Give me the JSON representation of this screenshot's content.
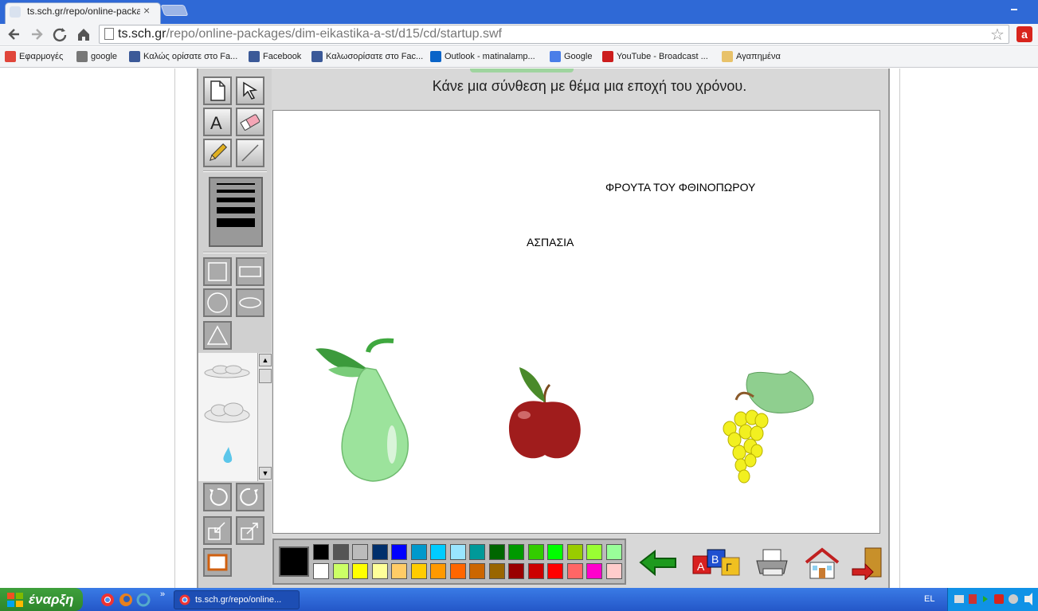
{
  "browser": {
    "tab_title": "ts.sch.gr/repo/online-packag",
    "tab_close": "×",
    "url_host": "ts.sch.gr",
    "url_path": "/repo/online-packages/dim-eikastika-a-st/d15/cd/startup.swf",
    "bookmarks": [
      {
        "label": "Εφαρμογές",
        "icon": "apps-icon",
        "color": "#e0453a"
      },
      {
        "label": "google",
        "icon": "search-icon",
        "color": "#777777"
      },
      {
        "label": "Καλώς ορίσατε στο Fa...",
        "icon": "facebook-icon",
        "color": "#3b5998"
      },
      {
        "label": "Facebook",
        "icon": "facebook-icon",
        "color": "#3b5998"
      },
      {
        "label": "Καλωσορίσατε στο Fac...",
        "icon": "facebook-icon",
        "color": "#3b5998"
      },
      {
        "label": "Outlook - matinalamp...",
        "icon": "outlook-icon",
        "color": "#0a64c8"
      },
      {
        "label": "Google",
        "icon": "google-icon",
        "color": "#4a7ee8"
      },
      {
        "label": "YouTube - Broadcast ...",
        "icon": "youtube-icon",
        "color": "#cc1d1d"
      },
      {
        "label": "Αγαπημένα",
        "icon": "folder-icon",
        "color": "#e8c26a"
      }
    ]
  },
  "app": {
    "instruction": "Κάνε μια σύνθεση με θέμα μια εποχή του χρόνου.",
    "canvas_texts": {
      "title": "ΦΡΟΥΤΑ ΤΟΥ ΦΘΙΝΟΠΩΡΟΥ",
      "name": "ΑΣΠΑΣΙΑ"
    },
    "current_color": "#000000",
    "palette_top": [
      "#000000",
      "#555555",
      "#bbbbbb",
      "#002f6c",
      "#0000ff",
      "#0099cc",
      "#00ccff",
      "#99e5ff",
      "#009999",
      "#006600",
      "#009900",
      "#33cc00",
      "#00ff00",
      "#99cc00",
      "#99ff33",
      "#99ff99"
    ],
    "palette_bottom": [
      "#ffffff",
      "#ccff66",
      "#ffff00",
      "#ffff99",
      "#ffcc66",
      "#ffcc00",
      "#ff9900",
      "#ff6600",
      "#cc6600",
      "#996600",
      "#990000",
      "#cc0000",
      "#ff0000",
      "#ff6666",
      "#ff00cc",
      "#ffcccc"
    ]
  },
  "taskbar": {
    "start_label": "έναρξη",
    "task_label": "ts.sch.gr/repo/online...",
    "lang": "EL",
    "chevron": "»"
  }
}
